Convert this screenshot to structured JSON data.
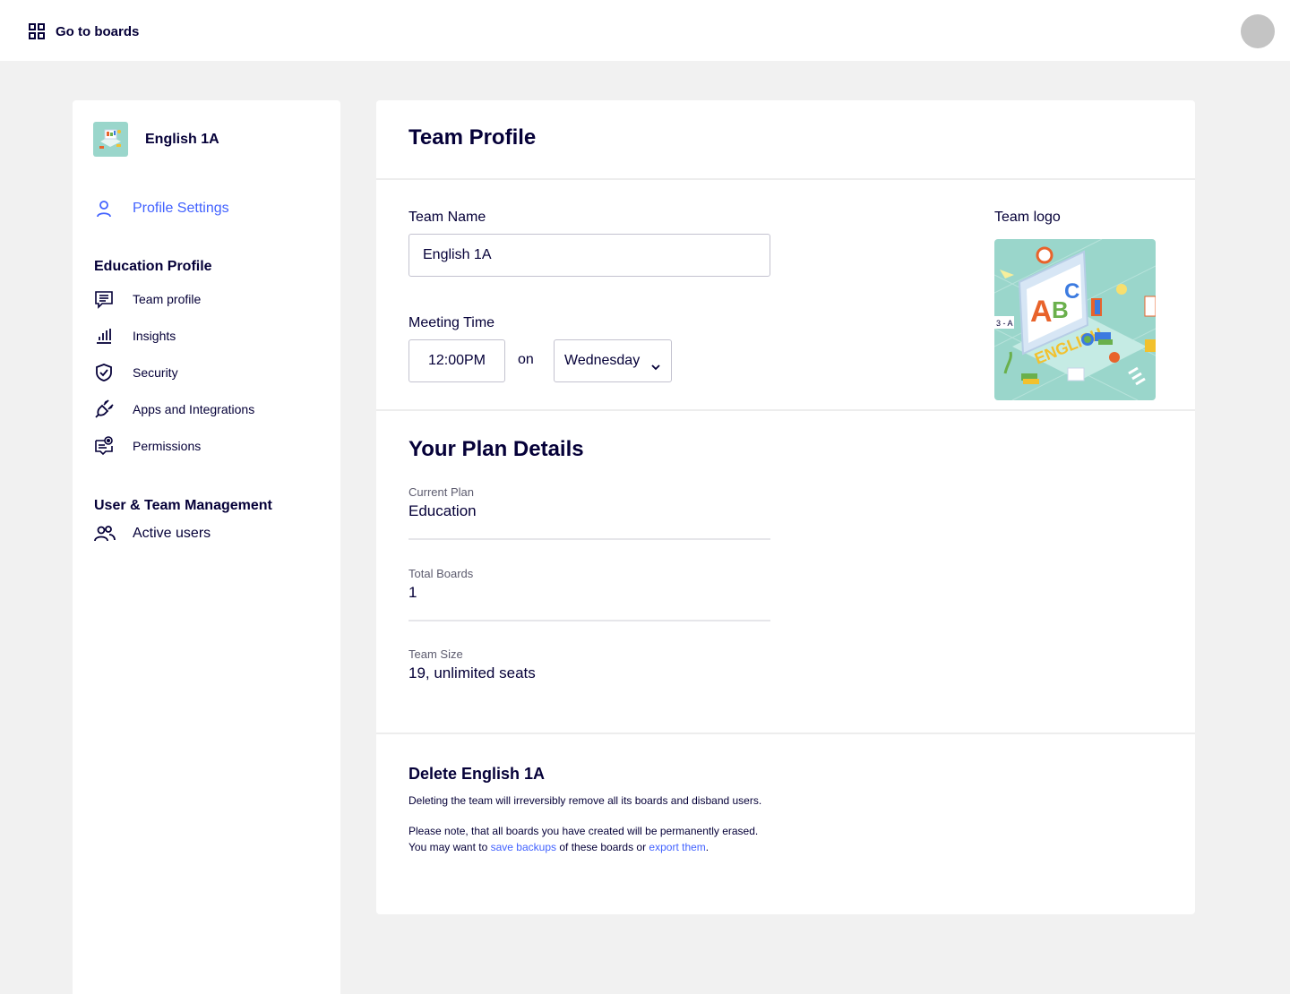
{
  "topbar": {
    "go_to_boards": "Go to boards"
  },
  "sidebar": {
    "team_name": "English 1A",
    "profile_settings": "Profile Settings",
    "education_section": "Education Profile",
    "education_items": [
      {
        "label": "Team profile",
        "icon": "list-icon"
      },
      {
        "label": "Insights",
        "icon": "bar-chart-icon"
      },
      {
        "label": "Security",
        "icon": "shield-check-icon"
      },
      {
        "label": "Apps and Integrations",
        "icon": "plug-icon"
      },
      {
        "label": "Permissions",
        "icon": "permissions-icon"
      }
    ],
    "user_section": "User & Team Management",
    "user_items": [
      {
        "label": "Active users",
        "icon": "users-icon"
      }
    ]
  },
  "main": {
    "title": "Team Profile",
    "team_name_label": "Team Name",
    "team_name_value": "English 1A",
    "meeting_time_label": "Meeting Time",
    "meeting_time_value": "12:00PM",
    "on_label": "on",
    "meeting_day_value": "Wednesday",
    "team_logo_label": "Team logo",
    "logo_text": {
      "a": "A",
      "b": "B",
      "c": "C",
      "word": "ENGLISH",
      "tag": "3 - A"
    }
  },
  "plan": {
    "title": "Your Plan Details",
    "rows": [
      {
        "label": "Current Plan",
        "value": "Education"
      },
      {
        "label": "Total Boards",
        "value": "1"
      },
      {
        "label": "Team Size",
        "value": "19, unlimited seats"
      }
    ]
  },
  "delete": {
    "title": "Delete English 1A",
    "line1": "Deleting the team will irreversibly remove all its boards and disband users.",
    "line2": "Please note, that all boards you have created will be permanently erased.",
    "line3_prefix": "You may want to ",
    "link1": "save backups",
    "line3_middle": " of these boards or ",
    "link2": "export them",
    "line3_suffix": "."
  },
  "colors": {
    "accent": "#4262ff",
    "text": "#050038",
    "background": "#f1f1f1",
    "logo_background": "#9ad6cb"
  }
}
